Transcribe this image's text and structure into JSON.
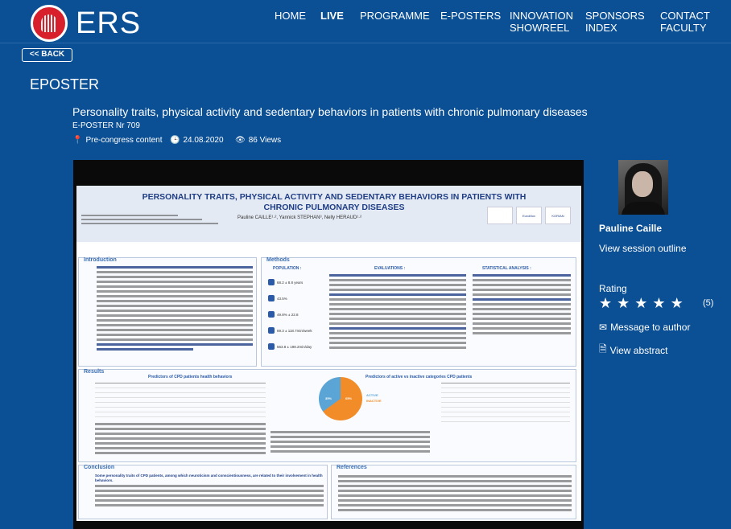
{
  "header": {
    "logo_text": "ERS",
    "nav": [
      {
        "label": "HOME",
        "lines": [
          "HOME"
        ],
        "active": false
      },
      {
        "label": "LIVE",
        "lines": [
          "LIVE"
        ],
        "active": true
      },
      {
        "label": "PROGRAMME",
        "lines": [
          "PROGRAMME"
        ],
        "active": false
      },
      {
        "label": "E-POSTERS",
        "lines": [
          "E-POSTERS"
        ],
        "active": false
      },
      {
        "label": "INNOVATION SHOWREEL",
        "lines": [
          "INNOVATION",
          "SHOWREEL"
        ],
        "active": false
      },
      {
        "label": "SPONSORS INDEX",
        "lines": [
          "SPONSORS",
          "INDEX"
        ],
        "active": false
      },
      {
        "label": "CONTACT FACULTY",
        "lines": [
          "CONTACT",
          "FACULTY"
        ],
        "active": false
      }
    ]
  },
  "back_label": "<< BACK",
  "section_title": "EPOSTER",
  "poster": {
    "title": "Personality traits, physical activity and sedentary behaviors in patients with chronic pulmonary diseases",
    "number": "E-POSTER Nr 709",
    "category": "Pre-congress content",
    "date": "24.08.2020",
    "views": "86 Views"
  },
  "poster_image": {
    "title": "PERSONALITY TRAITS, PHYSICAL ACTIVITY AND SEDENTARY BEHAVIORS IN PATIENTS WITH CHRONIC PULMONARY DISEASES",
    "authors": "Pauline CAILLE¹·², Yannick STEPHAN³, Nelly HERAUD¹·²",
    "logos": [
      "EuroMov",
      "KORIAN"
    ],
    "sections": {
      "introduction": "Introduction",
      "methods": "Methods",
      "population": "POPULATION :",
      "evaluations": "EVALUATIONS :",
      "statistical": "STATISTICAL ANALYSIS :",
      "results": "Results",
      "conclusion": "Conclusion",
      "references": "References"
    },
    "population_stats": [
      "68.2 ± 8.8 years",
      "43.5%",
      "49.8% ± 22.8",
      "69.3 ± 118.7min/week",
      "563.8 ± 198.2min/day"
    ],
    "results_headers": [
      "Predictors of CPD patients health behaviors",
      "Predictors of active vs inactive categories CPD patients"
    ],
    "pie_labels": [
      "ACTIVE",
      "INACTIVE"
    ],
    "pie_values": [
      "35%",
      "65%"
    ],
    "conclusion_lead": "Some personality traits of CPD patients, among which neuroticism and conscientiousness, are related to their involvement in health behaviors."
  },
  "presenter": {
    "name": "Pauline Caille",
    "session_link": "View session outline",
    "rating_label": "Rating",
    "rating_stars": 5,
    "rating_count": "(5)",
    "message_link": "Message to author",
    "abstract_link": "View abstract"
  },
  "colors": {
    "background": "#0b4f94",
    "logo_red": "#d8202c",
    "poster_title_blue": "#1f3e86",
    "pie_orange": "#f28c28",
    "pie_blue": "#5aa5d6"
  }
}
